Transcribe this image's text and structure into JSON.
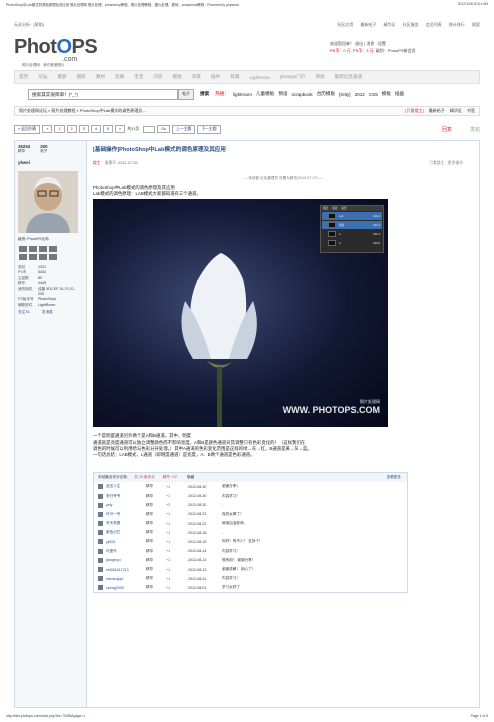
{
  "print_header": {
    "left": "PhotoShop中Lab模式的调色原理及其应用 照片处理网 照片处理、photoshop教程、照片处理教程、图片处理、数码、scrapbook教程 - Powered by phpwind",
    "right": "2012/10/8 20:01 AM"
  },
  "topbar": {
    "left": "无诉分析 · [帮助]",
    "links": [
      "社区应用",
      "最新帖子",
      "精华区",
      "社区服务",
      "会员列表",
      "统计排行",
      "搜索"
    ]
  },
  "logo": {
    "brand_prefix": "Phot",
    "brand_o": "O",
    "brand_suffix": "PS",
    "domain": ".com",
    "slogan": "照片处理网 · 我们都爱照片"
  },
  "userbox": {
    "line1": "欢迎您回来！ 退出 | 消息 · 设置",
    "ps_coin_label": "PS币：0 元",
    "ps_score_label": "PS币：3 元",
    "level": "级别：PhotoPS新会员"
  },
  "nav": {
    "items": [
      "首页",
      "论坛",
      "最新",
      "摄影",
      "教材",
      "后期",
      "宝宝",
      "问答",
      "模板",
      "背景",
      "插件",
      "剪辑",
      "Lightroom",
      "photops门户",
      "添加",
      "最新信息速递"
    ]
  },
  "search": {
    "placeholder": "搜索其实很简单！(*_*)",
    "button": "帖子",
    "submit": "搜索",
    "hot_label": "热搜：",
    "hot": [
      "lightroom",
      "儿童模板",
      "预设",
      "scrapbook",
      "台历模板",
      "[Kitty]",
      "2012",
      "CS5",
      "模板",
      "插画"
    ]
  },
  "breadcrumb": {
    "path": "照片处理网论坛 » 照片处理教程 » PhotoShop中Lab模式的调色原理及...",
    "right": [
      "[只看楼主]",
      "最新帖子",
      "精华区",
      "书签"
    ]
  },
  "pager": {
    "items": [
      "« 返回列表",
      "«",
      "1",
      "2",
      "3",
      "4",
      "5",
      "»",
      "共31页",
      "Go",
      "上一主题",
      "下一主题"
    ],
    "reply": "回复",
    "post": "发帖"
  },
  "author": {
    "stat1_num": "36253",
    "stat1_label": "精华",
    "stat2_num": "200",
    "stat2_label": "帖子",
    "name": "ykwei",
    "group": "级别: PhotoPS元帅",
    "details": [
      [
        "发帖",
        "1321"
      ],
      [
        "PS币",
        "5434"
      ],
      [
        "主贴数",
        "89"
      ],
      [
        "精华",
        "4449"
      ],
      [
        "我的相机",
        "佳能 5D2 EF 24-70,70-200"
      ],
      [
        "PS版本号",
        "PhotoShop"
      ],
      [
        "辅助软件",
        "LightRoom"
      ]
    ],
    "actions": [
      "关注TA",
      "发消息"
    ]
  },
  "post": {
    "title": "[基础操作]PhotoShop中Lab模式的调色原理及其应用",
    "floor": "楼主",
    "time": "发表于: 2012-07-26",
    "right": "只看楼主 · 更多操作",
    "edited": "— 本帖被 论坛管理员 设置为精华(2012-07-27) —",
    "body": [
      "PhotoShop中Lab模式的调色原理及其应用",
      "Lab模式的调色原理：LAB模式大家都知道有三个通道。"
    ],
    "panel_tabs": [
      "图层",
      "通道",
      "路径"
    ],
    "channels": [
      {
        "name": "Lab",
        "key": "Ctrl+2"
      },
      {
        "name": "明度",
        "key": "Ctrl+3"
      },
      {
        "name": "a",
        "key": "Ctrl+4"
      },
      {
        "name": "b",
        "key": "Ctrl+5"
      }
    ],
    "watermark": "WWW. PHOTOPS.COM",
    "watermark_cn": "照片处理网",
    "after": [
      "一个是明度通道另外两个是A和B通道。其中，明度",
      "通道就是亮度通道可以独立调整颜色而不影响亮度，A和B是颜色通道对其调整只有色彩变化的！（这样我们在",
      "调色的时候可以利用哈与色彩分开处理。）其中A通道的色彩变化范围是这样的绿→灰→红，B通道是黄→灰→蓝。",
      "一句话总结：LAB模式，L通道（即明度通道）是亮度，A、B两个通道是色彩通道。"
    ]
  },
  "rating": {
    "head_label": "本帖最近评分记录：",
    "count": "共 20 条评分",
    "score": "精华 +22",
    "hide": "隐藏",
    "more": "查看更多",
    "rows": [
      [
        "诺言人生",
        "精华",
        "+1",
        "2012-08-30",
        "谢谢分享！"
      ],
      [
        "老归爷爷",
        "精华",
        "+1",
        "2012-08-30",
        "内容学习！"
      ],
      [
        "yzfy",
        "精华",
        "+3",
        "2012-08-30",
        "-"
      ],
      [
        "可可一号",
        "精华",
        "+1",
        "2012-08-23",
        "真的太棒了！"
      ],
      [
        "冬天来看",
        "精华",
        "+1",
        "2012-08-22",
        "继续加油老师。"
      ],
      [
        "紫色记忆",
        "精华",
        "+1",
        "2012-08-16",
        "-"
      ],
      [
        "yjt321",
        "精华",
        "+1",
        "2012-08-15",
        "你好！有不少？ 支持个！"
      ],
      [
        "可爱鸟",
        "精华",
        "+1",
        "2012-08-14",
        "内容学习！"
      ],
      [
        "jiangeryu",
        "精华",
        "+1",
        "2012-08-13",
        "很有用！ 谢谢分享！"
      ],
      [
        "zkt281617213",
        "精华",
        "+1",
        "2012-08-13",
        "谢谢讲解！ 用心了！"
      ],
      [
        "chenzujupi",
        "精华",
        "+1",
        "2012-08-01",
        "内容学习！"
      ],
      [
        "xpeng2005",
        "精华",
        "+1",
        "2012-08-01",
        "学习太好了"
      ]
    ]
  },
  "footer": {
    "left": "http://bbs.photops.com/read.php?tid=70096&page=1",
    "right": "Page 1 of 8"
  }
}
